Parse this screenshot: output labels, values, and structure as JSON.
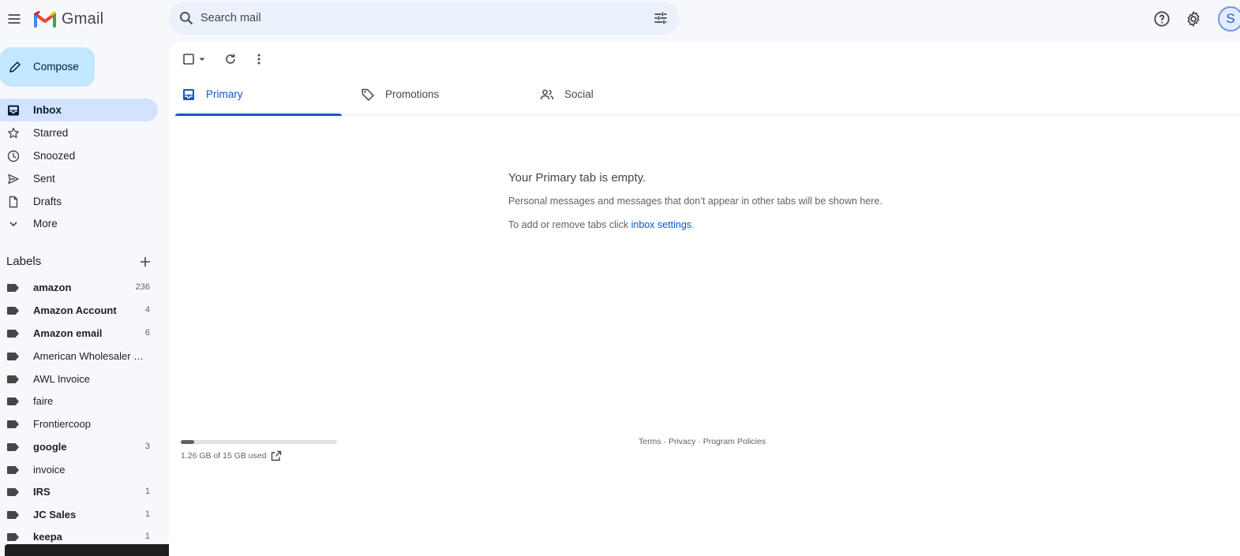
{
  "header": {
    "app_name": "Gmail",
    "search_placeholder": "Search mail",
    "avatar_initial": "S",
    "icons": [
      "menu-icon",
      "gmail-logo",
      "search-icon",
      "search-options-icon",
      "help-icon",
      "settings-icon"
    ]
  },
  "sidebar": {
    "compose_label": "Compose",
    "nav": [
      {
        "label": "Inbox",
        "icon": "inbox-icon",
        "active": true
      },
      {
        "label": "Starred",
        "icon": "star-icon"
      },
      {
        "label": "Snoozed",
        "icon": "clock-icon"
      },
      {
        "label": "Sent",
        "icon": "send-icon"
      },
      {
        "label": "Drafts",
        "icon": "draft-icon"
      },
      {
        "label": "More",
        "icon": "chevron-down-icon"
      }
    ],
    "labels_heading": "Labels",
    "labels": [
      {
        "name": "amazon",
        "count": "236",
        "bold": true
      },
      {
        "name": "Amazon Account",
        "count": "4",
        "bold": true
      },
      {
        "name": "Amazon email",
        "count": "6",
        "bold": true
      },
      {
        "name": "American Wholesaler S...",
        "count": "",
        "bold": false
      },
      {
        "name": "AWL Invoice",
        "count": "",
        "bold": false
      },
      {
        "name": "faire",
        "count": "",
        "bold": false
      },
      {
        "name": "Frontiercoop",
        "count": "",
        "bold": false
      },
      {
        "name": "google",
        "count": "3",
        "bold": true
      },
      {
        "name": "invoice",
        "count": "",
        "bold": false
      },
      {
        "name": "IRS",
        "count": "1",
        "bold": true
      },
      {
        "name": "JC Sales",
        "count": "1",
        "bold": true
      },
      {
        "name": "keepa",
        "count": "1",
        "bold": true
      }
    ]
  },
  "main": {
    "tabs": [
      {
        "label": "Primary",
        "icon": "inbox-tab-icon",
        "active": true
      },
      {
        "label": "Promotions",
        "icon": "tag-icon"
      },
      {
        "label": "Social",
        "icon": "people-icon"
      }
    ],
    "empty_title": "Your Primary tab is empty.",
    "empty_line1": "Personal messages and messages that don’t appear in other tabs will be shown here.",
    "empty_line2_prefix": "To add or remove tabs click ",
    "empty_line2_link": "inbox settings",
    "empty_line2_suffix": ".",
    "storage_text": "1.26 GB of 15 GB used",
    "storage_fraction": 0.084,
    "footer": {
      "terms": "Terms",
      "privacy": "Privacy",
      "policies": "Program Policies",
      "separator": " · "
    }
  },
  "colors": {
    "page_bg": "#f6f8fc",
    "active_nav": "#d3e3fd",
    "compose_bg": "#c2e7ff",
    "accent": "#0b57d0"
  }
}
